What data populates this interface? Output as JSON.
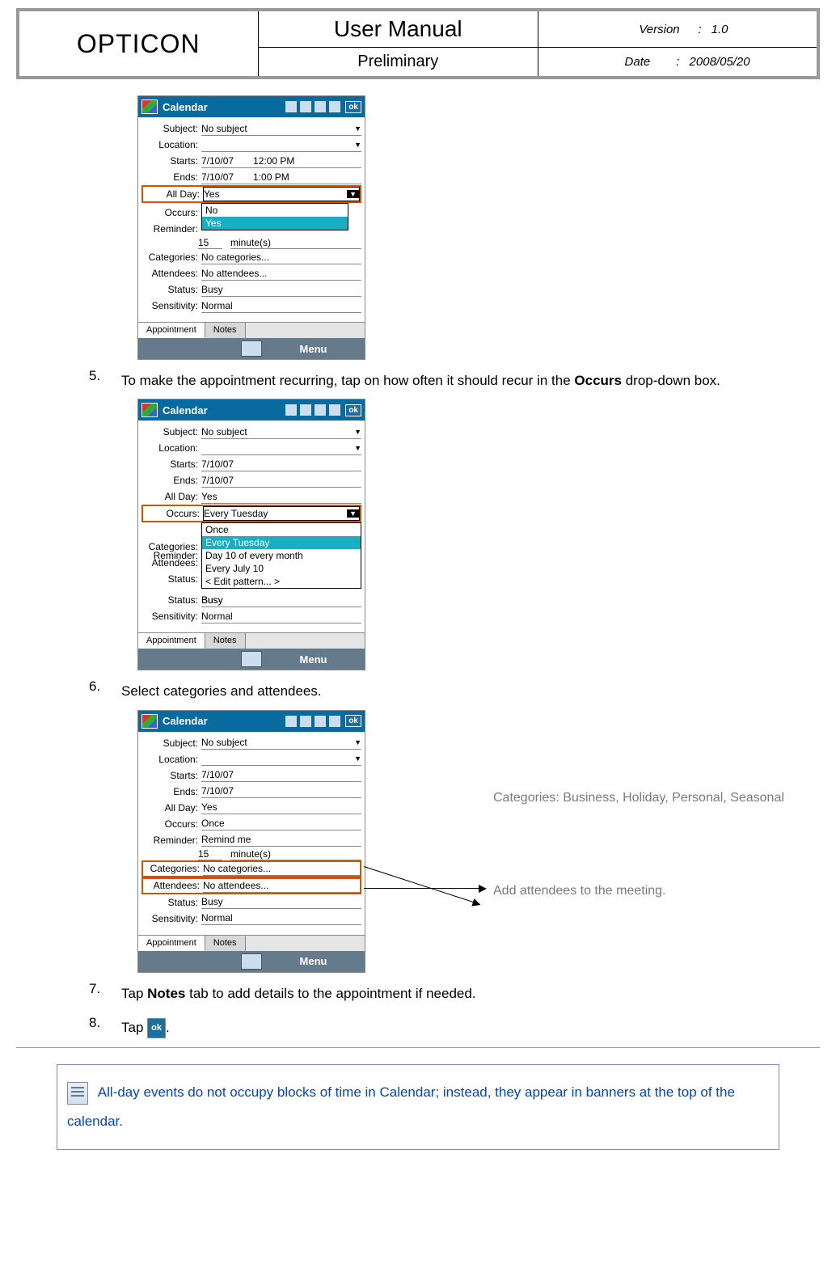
{
  "header": {
    "brand": "OPTICON",
    "title": "User Manual",
    "subtitle": "Preliminary",
    "version_label": "Version",
    "version_value": "1.0",
    "date_label": "Date",
    "date_value": "2008/05/20"
  },
  "phone_common": {
    "app_title": "Calendar",
    "ok_label": "ok",
    "tab_appointment": "Appointment",
    "tab_notes": "Notes",
    "menu_label": "Menu",
    "labels": {
      "subject": "Subject:",
      "location": "Location:",
      "starts": "Starts:",
      "ends": "Ends:",
      "allday": "All Day:",
      "occurs": "Occurs:",
      "reminder": "Reminder:",
      "categories": "Categories:",
      "attendees": "Attendees:",
      "status": "Status:",
      "sensitivity": "Sensitivity:"
    }
  },
  "shot1": {
    "subject": "No subject",
    "starts_date": "7/10/07",
    "starts_time": "12:00 PM",
    "ends_date": "7/10/07",
    "ends_time": "1:00 PM",
    "allday": "Yes",
    "dd_no": "No",
    "dd_yes": "Yes",
    "rem_qty": "15",
    "rem_unit": "minute(s)",
    "categories": "No categories...",
    "attendees": "No attendees...",
    "status": "Busy",
    "sensitivity": "Normal"
  },
  "step5": {
    "num": "5.",
    "text_a": "To make the appointment recurring, tap on how often it should recur in the ",
    "bold": "Occurs",
    "text_b": " drop-down box."
  },
  "shot2": {
    "subject": "No subject",
    "starts_date": "7/10/07",
    "ends_date": "7/10/07",
    "allday": "Yes",
    "occurs": "Every Tuesday",
    "dd_once": "Once",
    "dd_every_tue": "Every Tuesday",
    "dd_day10": "Day 10 of every month",
    "dd_july10": "Every July 10",
    "dd_edit": "< Edit pattern... >",
    "status": "Busy",
    "sensitivity": "Normal"
  },
  "step6": {
    "num": "6.",
    "text": "Select categories and attendees."
  },
  "shot3": {
    "subject": "No subject",
    "starts_date": "7/10/07",
    "ends_date": "7/10/07",
    "allday": "Yes",
    "occurs": "Once",
    "reminder": "Remind me",
    "rem_qty": "15",
    "rem_unit": "minute(s)",
    "categories": "No categories...",
    "attendees": "No attendees...",
    "status": "Busy",
    "sensitivity": "Normal"
  },
  "annotations": {
    "cat": "Categories: Business, Holiday, Personal, Seasonal",
    "att": "Add attendees to the meeting."
  },
  "step7": {
    "num": "7.",
    "text_a": "Tap ",
    "bold": "Notes",
    "text_b": " tab to add details to the appointment if needed."
  },
  "step8": {
    "num": "8.",
    "text_a": "Tap ",
    "ok": "ok",
    "text_b": "."
  },
  "note": {
    "text": "All-day events do not occupy blocks of time in Calendar; instead, they appear in banners at the top of the calendar."
  }
}
